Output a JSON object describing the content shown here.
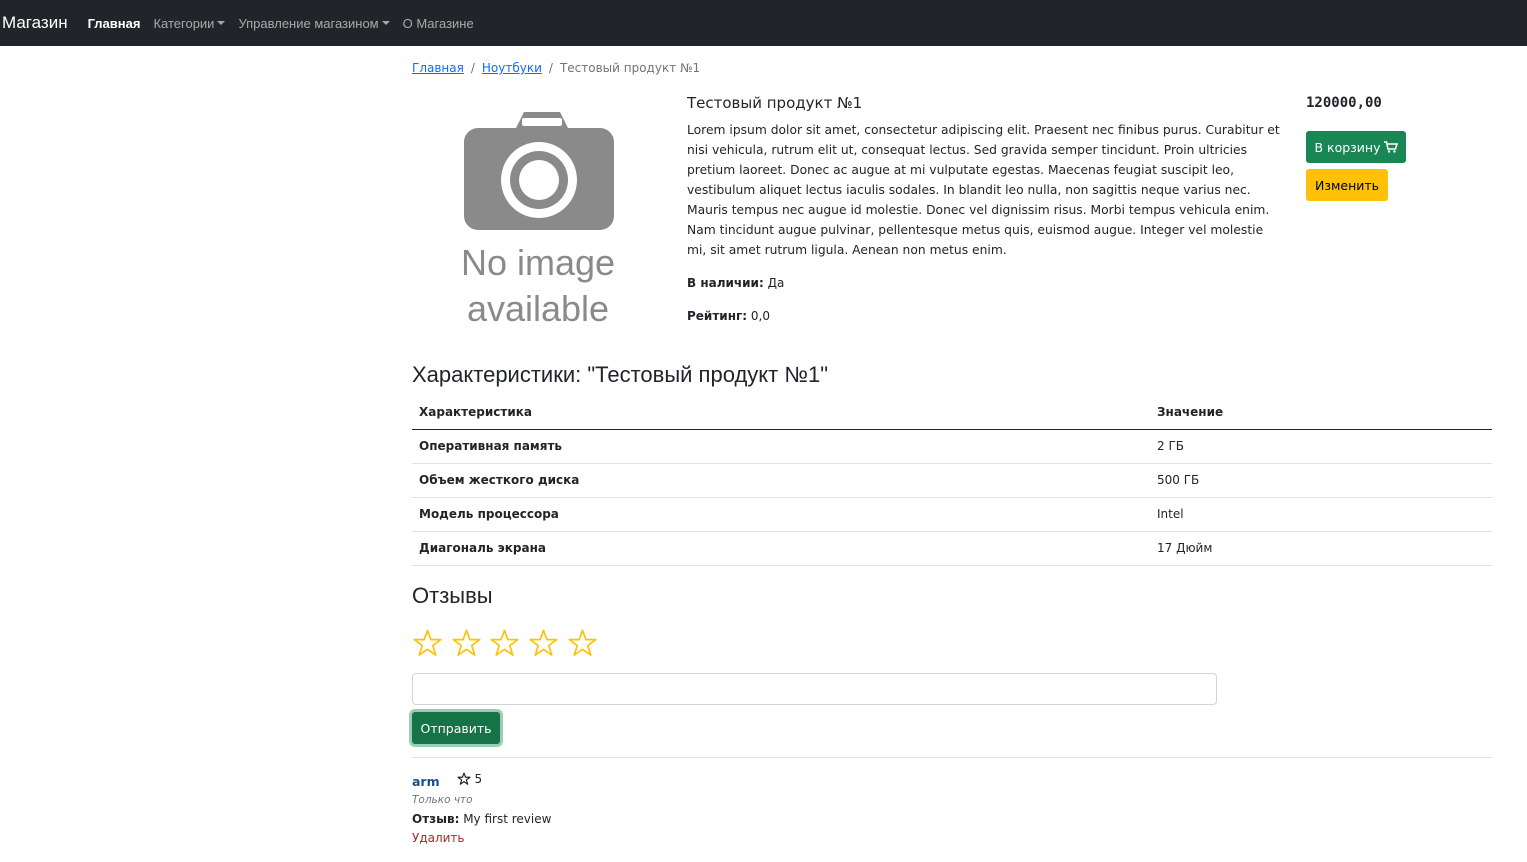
{
  "navbar": {
    "brand": "Магазин",
    "items": [
      {
        "label": "Главная"
      },
      {
        "label": "Категории"
      },
      {
        "label": "Управление магазином"
      },
      {
        "label": "О Магазине"
      }
    ]
  },
  "breadcrumb": {
    "home": "Главная",
    "category": "Ноутбуки",
    "current": "Тестовый продукт №1"
  },
  "product": {
    "image_text_line1": "No image",
    "image_text_line2": "available",
    "title": "Тестовый продукт №1",
    "description": "Lorem ipsum dolor sit amet, consectetur adipiscing elit. Praesent nec finibus purus. Curabitur et nisi vehicula, rutrum elit ut, consequat lectus. Sed gravida semper tincidunt. Proin ultricies pretium laoreet. Donec ac augue at mi vulputate egestas. Maecenas feugiat suscipit leo, vestibulum aliquet lectus iaculis sodales. In blandit leo nulla, non sagittis neque varius nec. Mauris tempus nec augue id molestie. Donec vel dignissim risus. Morbi tempus vehicula enim. Nam tincidunt augue pulvinar, pellentesque metus quis, euismod augue. Integer vel molestie mi, sit amet rutrum ligula. Aenean non metus enim.",
    "availability_label": "В наличии:",
    "availability_value": "Да",
    "rating_label": "Рейтинг:",
    "rating_value": "0,0",
    "price": "120000,00",
    "cart_button": "В корзину",
    "edit_button": "Изменить"
  },
  "characteristics": {
    "title": "Характеристики: \"Тестовый продукт №1\"",
    "header_name": "Характеристика",
    "header_value": "Значение",
    "rows": [
      {
        "name": "Оперативная память",
        "value": "2 ГБ"
      },
      {
        "name": "Объем жесткого диска",
        "value": "500 ГБ"
      },
      {
        "name": "Модель процессора",
        "value": "Intel"
      },
      {
        "name": "Диагональ экрана",
        "value": "17 Дюйм"
      }
    ]
  },
  "reviews": {
    "title": "Отзывы",
    "input_value": "",
    "send_button": "Отправить",
    "star_color": "#ffc107",
    "items": [
      {
        "author": "arm",
        "rating": "5",
        "time": "Только что",
        "text_label": "Отзыв:",
        "text": "My first review",
        "delete": "Удалить"
      }
    ]
  }
}
